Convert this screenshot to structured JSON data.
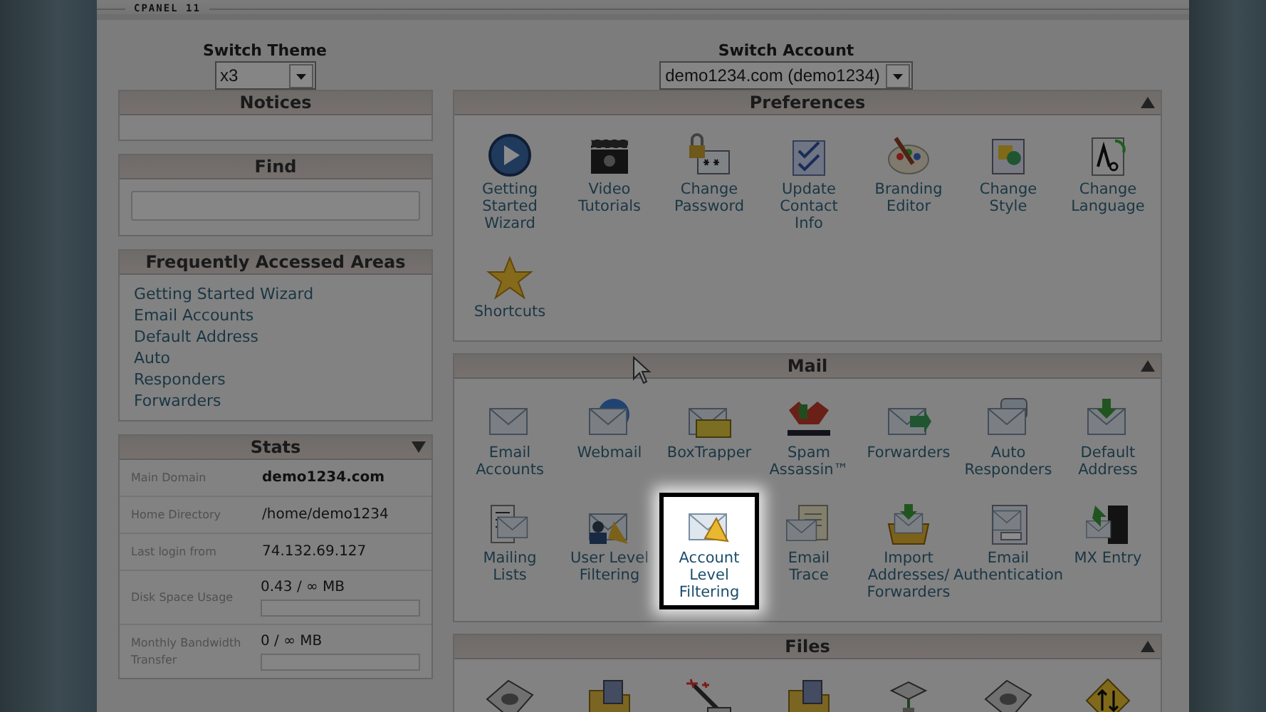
{
  "header": {
    "label": "CPANEL 11"
  },
  "switches": [
    {
      "title": "Switch Theme",
      "value": "x3"
    },
    {
      "title": "Switch Account",
      "value": "demo1234.com (demo1234)"
    }
  ],
  "sidebar": {
    "notices": {
      "title": "Notices"
    },
    "find": {
      "title": "Find"
    },
    "frequent": {
      "title": "Frequently Accessed Areas",
      "links": [
        "Getting Started Wizard",
        "Email Accounts",
        "Default Address",
        "Auto\nResponders",
        "Forwarders"
      ]
    },
    "stats": {
      "title": "Stats",
      "rows": [
        {
          "label": "Main Domain",
          "value": "demo1234.com",
          "emphasis": true
        },
        {
          "label": "Home Directory",
          "value": "/home/demo1234",
          "emphasis": false
        },
        {
          "label": "Last login from",
          "value": "74.132.69.127",
          "emphasis": false
        },
        {
          "label": "Disk Space Usage",
          "value": "0.43 / ∞ MB",
          "emphasis": false,
          "kind": "usage"
        },
        {
          "label": "Monthly Bandwidth\nTransfer",
          "value": "0 / ∞ MB",
          "emphasis": false,
          "kind": "usage"
        }
      ]
    }
  },
  "sections": [
    {
      "title": "Preferences",
      "items": [
        {
          "kind": "play",
          "label": "Getting\nStarted\nWizard",
          "selected": false
        },
        {
          "kind": "clapper",
          "label": "Video\nTutorials",
          "selected": false
        },
        {
          "kind": "lock",
          "label": "Change\nPassword",
          "selected": false
        },
        {
          "kind": "form",
          "label": "Update\nContact\nInfo",
          "selected": false
        },
        {
          "kind": "palette",
          "label": "Branding\nEditor",
          "selected": false
        },
        {
          "kind": "style",
          "label": "Change\nStyle",
          "selected": false
        },
        {
          "kind": "language",
          "label": "Change\nLanguage",
          "selected": false
        },
        {
          "kind": "star",
          "label": "Shortcuts",
          "selected": false
        }
      ]
    },
    {
      "title": "Mail",
      "items": [
        {
          "kind": "envelope",
          "label": "Email\nAccounts",
          "selected": false
        },
        {
          "kind": "globe",
          "label": "Webmail",
          "selected": false
        },
        {
          "kind": "box",
          "label": "BoxTrapper",
          "selected": false
        },
        {
          "kind": "spam",
          "label": "Spam\nAssassin™",
          "selected": false
        },
        {
          "kind": "forward",
          "label": "Forwarders",
          "selected": false
        },
        {
          "kind": "bubble",
          "label": "Auto\nResponders",
          "selected": false
        },
        {
          "kind": "download",
          "label": "Default\nAddress",
          "selected": false
        },
        {
          "kind": "list",
          "label": "Mailing\nLists",
          "selected": false
        },
        {
          "kind": "user",
          "label": "User Level\nFiltering",
          "selected": false
        },
        {
          "kind": "filter",
          "label": "Account\nLevel\nFiltering",
          "selected": true
        },
        {
          "kind": "trace",
          "label": "Email\nTrace",
          "selected": false
        },
        {
          "kind": "import",
          "label": "Import\nAddresses/\nForwarders",
          "selected": false
        },
        {
          "kind": "auth",
          "label": "Email\nAuthentication",
          "selected": false
        },
        {
          "kind": "server",
          "label": "MX Entry",
          "selected": false
        }
      ]
    },
    {
      "title": "Files",
      "items": [
        {
          "kind": "drive",
          "selected": false
        },
        {
          "kind": "folder",
          "selected": false
        },
        {
          "kind": "wand",
          "selected": false
        },
        {
          "kind": "folder",
          "selected": false
        },
        {
          "kind": "network",
          "selected": false
        },
        {
          "kind": "drive",
          "selected": false
        },
        {
          "kind": "updown",
          "selected": false
        }
      ]
    }
  ]
}
